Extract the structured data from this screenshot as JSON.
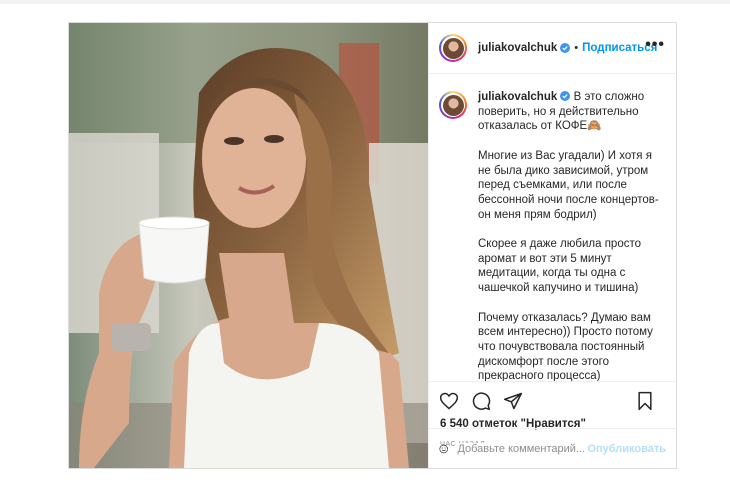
{
  "post": {
    "username": "juliakovalchuk",
    "follow_label": "Подписаться",
    "header_separator": "•",
    "more_label": "•••",
    "caption_paragraphs": [
      "В это сложно поверить, но я действительно отказалась от КОФЕ🙈",
      "Многие из Вас угадали) И хотя я не была дико зависимой, утром перед съемками, или после бессонной ночи после концертов- он меня прям бодрил)",
      "Скорее я даже любила просто аромат и вот эти 5 минут медитации, когда ты одна с чашечкой капучино и тишина)",
      "Почему отказалась? Думаю вам всем интересно)) Просто потому что почувствовала постоянный дискомфорт после этого прекрасного процесса)"
    ],
    "likes_text": "6 540 отметок \"Нравится\"",
    "time_text": "ЧАС НАЗАД",
    "comment_placeholder": "Добавьте комментарий...",
    "publish_label": "Опубликовать"
  },
  "icons": {
    "verified": "verified-badge-icon",
    "like": "heart-icon",
    "comment": "comment-icon",
    "share": "share-icon",
    "save": "bookmark-icon",
    "emoji": "emoji-icon",
    "more": "more-options-icon"
  },
  "colors": {
    "accent": "#0095f6",
    "publish_disabled": "#b2dffc",
    "border": "#dbdbdb",
    "muted": "#8e8e8e"
  }
}
